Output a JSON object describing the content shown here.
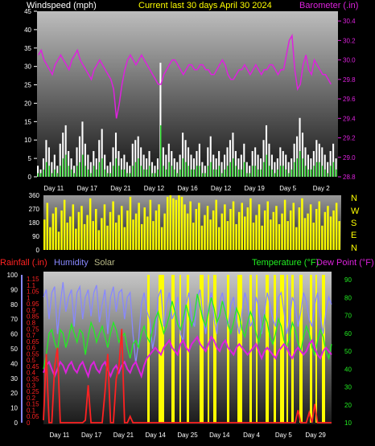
{
  "header": {
    "left_title": "Windspeed (mph)",
    "center_title": "Current last 30 days April 30 2024",
    "right_title": "Barometer (.in)"
  },
  "colors": {
    "background": "#000000",
    "white": "#ffffff",
    "wind": "#ffffff",
    "gust": "#22dd22",
    "barometer": "#dd22dd",
    "center_title": "#ffff00",
    "direction": "#ffff00",
    "rainfall": "#ff2222",
    "humidity": "#8888ff",
    "solar": "#bbbb88",
    "temperature": "#22ee22",
    "dewpoint": "#dd22dd",
    "rain_axis": "#ff2222",
    "humidity_axis": "#8888ff",
    "temp_axis": "#22ee22",
    "baro_axis": "#dd22dd"
  },
  "chart_data": [
    {
      "type": "bar",
      "name": "wind",
      "title": "Windspeed (mph)",
      "right_title": "Barometer (.in)",
      "ylim": [
        0,
        45
      ],
      "y_ticks": [
        0,
        5,
        10,
        15,
        20,
        25,
        30,
        35,
        40,
        45
      ],
      "y2lim": [
        28.8,
        30.5
      ],
      "y2_ticks": [
        28.8,
        29.0,
        29.2,
        29.4,
        29.6,
        29.8,
        30.0,
        30.2,
        30.4
      ],
      "x_labels": [
        "Day 11",
        "Day 17",
        "Day 21",
        "Day 12",
        "Day 16",
        "Day 12",
        "Day 19",
        "Day 5",
        "Day 2"
      ],
      "series": [
        {
          "name": "wind",
          "values": [
            3,
            2,
            5,
            10,
            8,
            4,
            6,
            3,
            9,
            12,
            14,
            7,
            5,
            3,
            8,
            11,
            15,
            9,
            6,
            4,
            7,
            5,
            10,
            13,
            6,
            3,
            4,
            8,
            12,
            7,
            5,
            6,
            4,
            3,
            9,
            10,
            11,
            8,
            6,
            5,
            7,
            4,
            3,
            5,
            31,
            8,
            6,
            9,
            7,
            5,
            4,
            6,
            12,
            10,
            8,
            6,
            5,
            7,
            9,
            4,
            3,
            8,
            11,
            6,
            5,
            7,
            4,
            6,
            8,
            10,
            12,
            7,
            5,
            6,
            9,
            4,
            3,
            7,
            8,
            6,
            5,
            10,
            14,
            9,
            6,
            4,
            5,
            8,
            7,
            6,
            4,
            5,
            9,
            11,
            16,
            12,
            8,
            6,
            5,
            7,
            10,
            9,
            8,
            6,
            4,
            7,
            9,
            5
          ]
        },
        {
          "name": "gust",
          "values": [
            1,
            1,
            2,
            4,
            3,
            1,
            2,
            1,
            3,
            5,
            6,
            3,
            2,
            1,
            3,
            4,
            6,
            3,
            2,
            1,
            3,
            2,
            4,
            5,
            2,
            1,
            1,
            3,
            5,
            3,
            2,
            2,
            1,
            1,
            3,
            4,
            5,
            3,
            2,
            2,
            3,
            1,
            1,
            2,
            14,
            3,
            2,
            4,
            3,
            2,
            1,
            2,
            5,
            4,
            3,
            2,
            2,
            3,
            3,
            1,
            1,
            3,
            4,
            2,
            2,
            3,
            1,
            2,
            3,
            4,
            5,
            3,
            2,
            2,
            4,
            1,
            1,
            3,
            3,
            2,
            2,
            4,
            6,
            3,
            2,
            1,
            2,
            3,
            3,
            2,
            1,
            2,
            4,
            5,
            7,
            5,
            3,
            2,
            2,
            3,
            4,
            4,
            3,
            2,
            1,
            3,
            4,
            2
          ]
        },
        {
          "name": "barometer",
          "values": [
            30.05,
            30.1,
            30.0,
            29.95,
            29.9,
            29.85,
            29.95,
            30.0,
            30.05,
            30.0,
            29.95,
            29.9,
            30.0,
            30.05,
            30.1,
            30.0,
            29.95,
            29.9,
            29.85,
            29.8,
            29.9,
            29.95,
            30.0,
            29.95,
            29.9,
            29.85,
            29.8,
            29.7,
            29.4,
            29.55,
            29.75,
            29.9,
            30.0,
            30.05,
            30.0,
            29.95,
            30.0,
            30.05,
            30.0,
            29.95,
            29.9,
            29.85,
            29.8,
            29.75,
            29.75,
            29.85,
            29.9,
            29.95,
            30.0,
            30.0,
            29.95,
            29.9,
            29.85,
            29.9,
            29.95,
            29.95,
            29.9,
            29.9,
            29.95,
            29.95,
            29.9,
            29.9,
            29.85,
            29.85,
            29.9,
            29.95,
            30.0,
            29.95,
            29.85,
            29.8,
            29.8,
            29.85,
            29.9,
            29.9,
            29.95,
            29.9,
            29.85,
            29.9,
            29.95,
            29.9,
            29.85,
            29.9,
            29.9,
            29.95,
            29.95,
            29.9,
            29.85,
            29.9,
            29.9,
            30.05,
            30.2,
            30.25,
            29.9,
            29.7,
            29.75,
            29.95,
            30.05,
            29.9,
            29.85,
            30.0,
            29.95,
            29.9,
            29.85,
            29.85,
            29.8,
            29.75
          ]
        }
      ]
    },
    {
      "type": "bar",
      "name": "direction",
      "ylim": [
        0,
        360
      ],
      "y_ticks": [
        0,
        90,
        180,
        270,
        360
      ],
      "compass_labels": [
        "N",
        "W",
        "S",
        "E",
        "N"
      ],
      "series": [
        {
          "name": "direction",
          "values": [
            200,
            310,
            150,
            240,
            280,
            120,
            260,
            330,
            180,
            220,
            300,
            140,
            250,
            290,
            170,
            230,
            340,
            190,
            270,
            130,
            210,
            300,
            160,
            250,
            320,
            180,
            230,
            290,
            150,
            260,
            350,
            200,
            240,
            310,
            170,
            280,
            220,
            330,
            190,
            260,
            300,
            150,
            240,
            350,
            360,
            340,
            330,
            360,
            350,
            300,
            240,
            320,
            180,
            270,
            310,
            160,
            230,
            290,
            200,
            260,
            330,
            150,
            240,
            300,
            190,
            270,
            320,
            170,
            250,
            310,
            220,
            280,
            340,
            180,
            230,
            300,
            160,
            260,
            320,
            200,
            250,
            290,
            170,
            240,
            330,
            190,
            260,
            310,
            150,
            280,
            340,
            210,
            240,
            300,
            180,
            270,
            320,
            160,
            250,
            290,
            220,
            260,
            310,
            190
          ]
        }
      ]
    },
    {
      "type": "line",
      "name": "climate",
      "left_title": "Rainfall (.in)",
      "middle_title_1": "Humidity",
      "middle_title_2": "Solar",
      "right_title": "Temperature (°F)",
      "right_title_2": "Dew Point (°F)",
      "humidity_ticks": [
        0,
        10,
        20,
        30,
        40,
        50,
        60,
        70,
        80,
        90,
        100
      ],
      "rain_ticks": [
        "0",
        "0.05",
        "0.1",
        "0.15",
        "0.2",
        "0.25",
        "0.3",
        "0.35",
        "0.4",
        "0.45",
        "0.5",
        "0.55",
        "0.6",
        "0.65",
        "0.7",
        "0.75",
        "0.8",
        "0.85",
        "0.9",
        "0.95",
        "1",
        "1.05",
        "1.1",
        "1.15"
      ],
      "temp_ticks": [
        10,
        20,
        30,
        40,
        50,
        60,
        70,
        80,
        90
      ],
      "x_labels": [
        "Day 11",
        "Day 17",
        "Day 21",
        "Day 14",
        "Day 25",
        "Day 14",
        "Day 4",
        "Day 5",
        "Day 29"
      ],
      "series": [
        {
          "name": "humidity",
          "values": [
            85,
            90,
            70,
            88,
            92,
            60,
            80,
            95,
            75,
            85,
            90,
            65,
            88,
            92,
            70,
            85,
            90,
            72,
            88,
            93,
            68,
            80,
            90,
            60,
            85,
            92,
            75,
            88,
            90,
            70,
            85,
            88,
            60,
            40,
            55,
            80,
            88,
            75,
            70,
            50,
            60,
            85,
            90,
            65,
            80,
            88,
            70,
            75,
            85,
            60,
            55,
            80,
            88,
            70,
            65,
            85,
            90,
            72,
            60,
            78,
            88,
            70,
            60,
            82,
            88,
            75,
            65,
            80,
            85,
            70,
            60,
            75,
            88,
            80,
            65,
            70,
            85,
            78,
            60,
            75,
            88,
            80,
            70,
            65,
            85,
            88,
            75,
            60,
            70,
            85,
            80,
            65,
            75,
            88,
            82,
            70,
            65,
            80,
            88,
            72,
            60,
            75,
            85,
            80
          ]
        },
        {
          "name": "temperature",
          "values": [
            40,
            48,
            60,
            62,
            55,
            50,
            62,
            60,
            52,
            58,
            65,
            60,
            55,
            62,
            60,
            48,
            58,
            66,
            62,
            55,
            60,
            64,
            58,
            52,
            60,
            66,
            62,
            55,
            58,
            60,
            52,
            46,
            54,
            56,
            52,
            60,
            64,
            58,
            55,
            62,
            68,
            72,
            66,
            60,
            64,
            70,
            78,
            72,
            65,
            62,
            68,
            76,
            70,
            64,
            70,
            82,
            75,
            68,
            64,
            72,
            80,
            74,
            66,
            70,
            78,
            72,
            65,
            60,
            66,
            74,
            70,
            62,
            58,
            66,
            72,
            68,
            60,
            55,
            62,
            70,
            66,
            58,
            54,
            60,
            68,
            64,
            56,
            52,
            58,
            66,
            62,
            55,
            50,
            58,
            64,
            60,
            52,
            48,
            56,
            62,
            58,
            50,
            46,
            54
          ]
        },
        {
          "name": "dewpoint",
          "values": [
            38,
            42,
            44,
            40,
            36,
            40,
            44,
            42,
            38,
            42,
            44,
            40,
            38,
            42,
            44,
            40,
            36,
            42,
            44,
            40,
            38,
            42,
            44,
            40,
            36,
            40,
            42,
            38,
            42,
            44,
            40,
            38,
            42,
            44,
            40,
            36,
            42,
            46,
            48,
            50,
            52,
            50,
            48,
            52,
            54,
            56,
            52,
            50,
            48,
            54,
            56,
            52,
            50,
            54,
            56,
            58,
            54,
            52,
            50,
            54,
            58,
            56,
            52,
            50,
            54,
            56,
            52,
            50,
            48,
            52,
            54,
            52,
            50,
            48,
            50,
            52,
            54,
            50,
            46,
            50,
            52,
            50,
            48,
            46,
            50,
            52,
            54,
            52,
            48,
            46,
            50,
            52,
            50,
            48,
            50,
            54,
            56,
            52,
            48,
            46,
            50,
            52,
            50,
            48
          ]
        },
        {
          "name": "rainfall",
          "values": [
            0.02,
            0.55,
            0.0,
            0.0,
            0.45,
            0.6,
            0.0,
            0.0,
            0.0,
            0.0,
            0.0,
            0.0,
            0.0,
            0.0,
            0.0,
            0.02,
            0.3,
            0.0,
            0.0,
            0.0,
            0.0,
            0.0,
            0.25,
            0.55,
            0.0,
            0.0,
            0.35,
            0.45,
            0.75,
            0.0,
            0.0,
            0.05,
            0.0,
            0.0,
            0.0,
            0.0,
            0.0,
            0.0,
            0.0,
            0.0,
            0.0,
            0.0,
            0.0,
            0.0,
            0.0,
            0.0,
            0.0,
            0.0,
            0.0,
            0.0,
            0.0,
            0.0,
            0.0,
            0.0,
            0.0,
            0.0,
            0.0,
            0.0,
            0.0,
            0.0,
            0.0,
            0.0,
            0.0,
            0.0,
            0.0,
            0.0,
            0.0,
            0.0,
            0.0,
            0.0,
            0.0,
            0.0,
            0.0,
            0.0,
            0.0,
            0.0,
            0.0,
            0.0,
            0.0,
            0.0,
            0.0,
            0.0,
            0.0,
            0.0,
            0.0,
            0.0,
            0.0,
            0.0,
            0.0,
            0.0,
            0.0,
            0.1,
            0.0,
            0.0,
            0.0,
            0.08,
            0.0,
            0.15,
            0.0,
            0.0,
            0.0,
            0.0,
            0.0,
            0.0
          ]
        }
      ]
    }
  ]
}
